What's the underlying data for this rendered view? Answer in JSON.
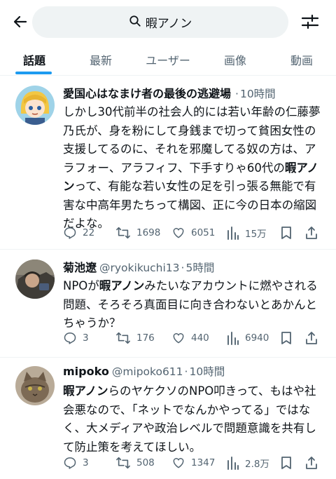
{
  "search": {
    "query": "暇アノン"
  },
  "tabs": [
    {
      "label": "話題"
    },
    {
      "label": "最新"
    },
    {
      "label": "ユーザー"
    },
    {
      "label": "画像"
    },
    {
      "label": "動画"
    }
  ],
  "active_tab": "話題",
  "colors": {
    "accent": "#1d9bf0",
    "text": "#0f1419",
    "muted": "#536471",
    "search_bg": "#eff3f4"
  },
  "posts": [
    {
      "name": "愛国心はなまけ者の最後の逃避場",
      "handle": "",
      "separator": "·",
      "time": "10時間",
      "text_before": "しかし30代前半の社会人的には若い年齢の仁藤夢乃氏が、身を粉にして身銭まで切って貧困女性の支援してるのに、それを邪魔してる奴の方は、アラフォー、アラフィフ、下手すりゃ60代の",
      "highlight": "暇アノン",
      "text_after": "って、有能な若い女性の足を引っ張る無能で有害な中高年男たちって構図、正に今の日本の縮図だよな。",
      "replies": "22",
      "reposts": "1698",
      "likes": "6051",
      "views": "15万"
    },
    {
      "name": "菊池遼",
      "handle": "@ryokikuchi13",
      "separator": "·",
      "time": "5時間",
      "text_before": "NPOが",
      "highlight": "暇アノン",
      "text_after": "みたいなアカウントに燃やされる問題、そろそろ真面目に向き合わないとあかんとちゃうか？",
      "replies": "3",
      "reposts": "176",
      "likes": "440",
      "views": "6940"
    },
    {
      "name": "mipoko",
      "handle": "@mipoko611",
      "separator": "·",
      "time": "10時間",
      "text_before": "",
      "highlight": "暇アノン",
      "text_after": "らのヤケクソのNPO叩きって、もはや社会悪なので、「ネットでなんかやってる」ではなく、大メディアや政治レベルで問題意識を共有して防止策を考えてほしい。",
      "replies": "3",
      "reposts": "508",
      "likes": "1347",
      "views": "2.8万"
    }
  ]
}
